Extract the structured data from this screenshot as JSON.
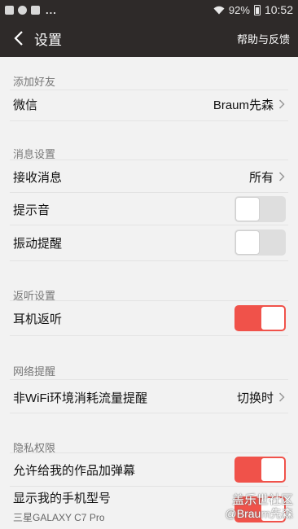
{
  "status_bar": {
    "battery": "92%",
    "time": "10:52",
    "dots": "..."
  },
  "app_bar": {
    "title": "设置",
    "help_label": "帮助与反馈"
  },
  "sections": {
    "add_friend": {
      "header": "添加好友",
      "wechat_label": "微信",
      "wechat_value": "Braum先森"
    },
    "messages": {
      "header": "消息设置",
      "receive_label": "接收消息",
      "receive_value": "所有",
      "sound_label": "提示音",
      "sound_on": false,
      "vibrate_label": "振动提醒",
      "vibrate_on": false
    },
    "monitor": {
      "header": "返听设置",
      "earphone_label": "耳机返听",
      "earphone_on": true
    },
    "network": {
      "header": "网络提醒",
      "nonwifi_label": "非WiFi环境消耗流量提醒",
      "nonwifi_value": "切换时"
    },
    "privacy": {
      "header": "隐私权限",
      "danmaku_label": "允许给我的作品加弹幕",
      "danmaku_on": true,
      "model_label": "显示我的手机型号",
      "model_sub": "三星GALAXY C7 Pro",
      "model_on": true
    }
  },
  "watermark": {
    "line1": "盖乐世社区",
    "line2": "@Braum先森"
  },
  "colors": {
    "toolbar": "#2e2a29",
    "accent": "#f0524a",
    "background": "#f2f2f2"
  }
}
